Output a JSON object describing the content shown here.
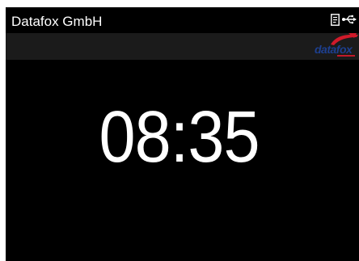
{
  "header": {
    "title": "Datafox GmbH",
    "icons": [
      "document-icon",
      "usb-icon"
    ]
  },
  "logo": {
    "text_main": "datafox",
    "brand_colors": {
      "blue": "#1d3f8f",
      "red": "#d11a2a"
    }
  },
  "clock": {
    "time": "08:35"
  },
  "colors": {
    "screen_background": "#000000",
    "info_strip": "#1b1b1b",
    "text": "#ffffff"
  }
}
